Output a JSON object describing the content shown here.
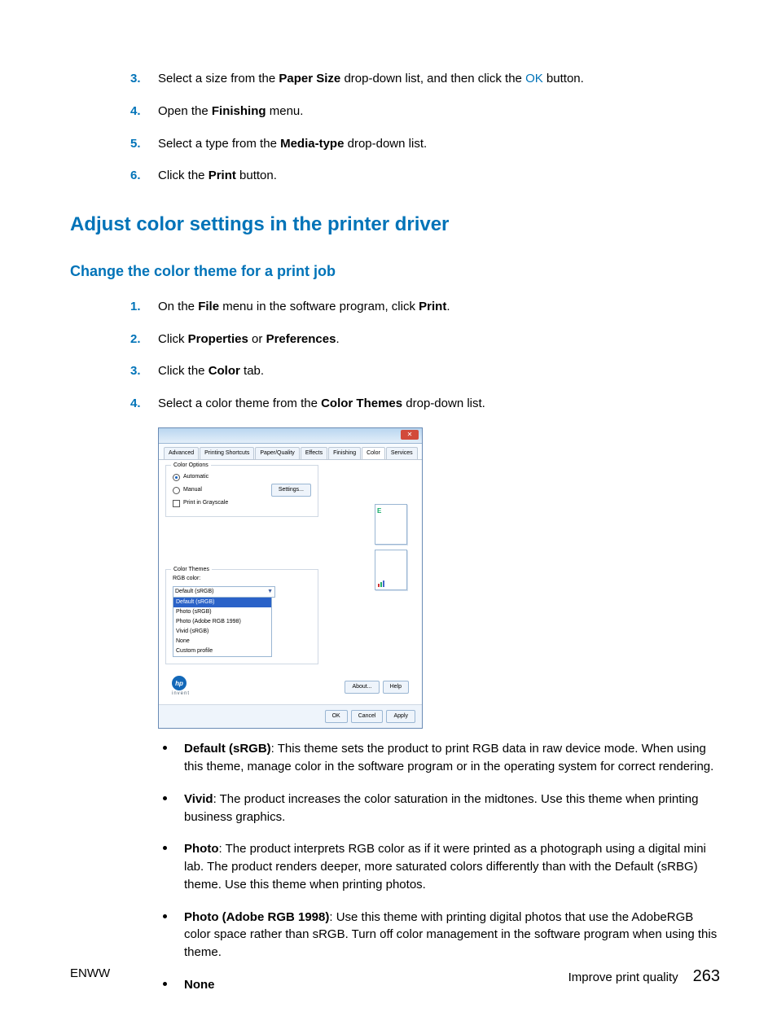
{
  "steps_top": [
    {
      "num": "3.",
      "pre": "Select a size from the ",
      "b1": "Paper Size",
      "mid": " drop-down list, and then click the ",
      "link": "OK",
      "post": " button."
    },
    {
      "num": "4.",
      "pre": "Open the ",
      "b1": "Finishing",
      "mid": " menu.",
      "link": "",
      "post": ""
    },
    {
      "num": "5.",
      "pre": "Select a type from the ",
      "b1": "Media-type",
      "mid": " drop-down list.",
      "link": "",
      "post": ""
    },
    {
      "num": "6.",
      "pre": "Click the ",
      "b1": "Print",
      "mid": " button.",
      "link": "",
      "post": ""
    }
  ],
  "heading1": "Adjust color settings in the printer driver",
  "heading2": "Change the color theme for a print job",
  "steps_mid": [
    {
      "num": "1.",
      "pre": "On the ",
      "b1": "File",
      "mid": " menu in the software program, click ",
      "b2": "Print",
      "post": "."
    },
    {
      "num": "2.",
      "pre": "Click ",
      "b1": "Properties",
      "mid": " or ",
      "b2": "Preferences",
      "post": "."
    },
    {
      "num": "3.",
      "pre": "Click the ",
      "b1": "Color",
      "mid": " tab.",
      "b2": "",
      "post": ""
    },
    {
      "num": "4.",
      "pre": "Select a color theme from the ",
      "b1": "Color Themes",
      "mid": " drop-down list.",
      "b2": "",
      "post": ""
    }
  ],
  "dialog": {
    "tabs": [
      "Advanced",
      "Printing Shortcuts",
      "Paper/Quality",
      "Effects",
      "Finishing",
      "Color",
      "Services"
    ],
    "active_tab": "Color",
    "group1_legend": "Color Options",
    "radio_auto": "Automatic",
    "radio_manual": "Manual",
    "settings_btn": "Settings...",
    "check_gray": "Print in Grayscale",
    "group2_legend": "Color Themes",
    "rgb_label": "RGB color:",
    "select_value": "Default (sRGB)",
    "options": [
      "Default (sRGB)",
      "Photo (sRGB)",
      "Photo (Adobe RGB 1998)",
      "Vivid (sRGB)",
      "None",
      "Custom profile"
    ],
    "about": "About...",
    "help": "Help",
    "ok": "OK",
    "cancel": "Cancel",
    "apply": "Apply",
    "invent": "invent"
  },
  "bullets": [
    {
      "b": "Default (sRGB)",
      "text": ": This theme sets the product to print RGB data in raw device mode. When using this theme, manage color in the software program or in the operating system for correct rendering."
    },
    {
      "b": "Vivid",
      "text": ": The product increases the color saturation in the midtones. Use this theme when printing business graphics."
    },
    {
      "b": "Photo",
      "text": ": The product interprets RGB color as if it were printed as a photograph using a digital mini lab. The product renders deeper, more saturated colors differently than with the Default (sRBG) theme. Use this theme when printing photos."
    },
    {
      "b": "Photo (Adobe RGB 1998)",
      "text": ": Use this theme with printing digital photos that use the AdobeRGB color space rather than sRGB. Turn off color management in the software program when using this theme."
    },
    {
      "b": "None",
      "text": ""
    }
  ],
  "footer_left": "ENWW",
  "footer_section": "Improve print quality",
  "footer_page": "263"
}
